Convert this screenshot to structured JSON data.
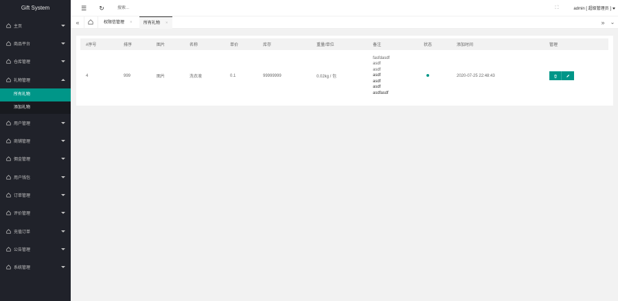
{
  "app": {
    "title": "Gift System"
  },
  "sidebar": {
    "items": [
      {
        "label": "主页",
        "expanded": false
      },
      {
        "label": "商品平台",
        "expanded": false
      },
      {
        "label": "仓库管理",
        "expanded": false
      },
      {
        "label": "礼物管理",
        "expanded": true,
        "children": [
          {
            "label": "所有礼物",
            "active": true
          },
          {
            "label": "添加礼物",
            "active": false
          }
        ]
      },
      {
        "label": "用户管理",
        "expanded": false
      },
      {
        "label": "商铺管理",
        "expanded": false
      },
      {
        "label": "佣金管理",
        "expanded": false
      },
      {
        "label": "用户钱包",
        "expanded": false
      },
      {
        "label": "订单管理",
        "expanded": false
      },
      {
        "label": "评价管理",
        "expanded": false
      },
      {
        "label": "充值订单",
        "expanded": false
      },
      {
        "label": "公告管理",
        "expanded": false
      },
      {
        "label": "系统管理",
        "expanded": false
      }
    ]
  },
  "header": {
    "search_placeholder": "搜索...",
    "admin_label": "admin [ 超级管理员 ]"
  },
  "tabs": [
    {
      "label": "权限信管理",
      "active": false
    },
    {
      "label": "所有礼物",
      "active": true
    }
  ],
  "table": {
    "columns": [
      "#序号",
      "排序",
      "图片",
      "名称",
      "单价",
      "库存",
      "重量/单位",
      "备注",
      "状态",
      "添加时间",
      "管理"
    ],
    "rows": [
      {
        "id": "4",
        "sort": "999",
        "image": "图片",
        "name": "洗衣液",
        "price": "0.1",
        "stock": "99999999",
        "weight": "0.02kg / 包",
        "note_lines": [
          "fasfdasdf",
          "asdf",
          "asdf",
          "asdf",
          "asdf",
          "asdf",
          "asdfasdf"
        ],
        "status_color": "#009688",
        "added_time": "2020-07-25 22:48:43"
      }
    ]
  },
  "colors": {
    "accent": "#009688",
    "sidebar_bg": "#20222a"
  }
}
